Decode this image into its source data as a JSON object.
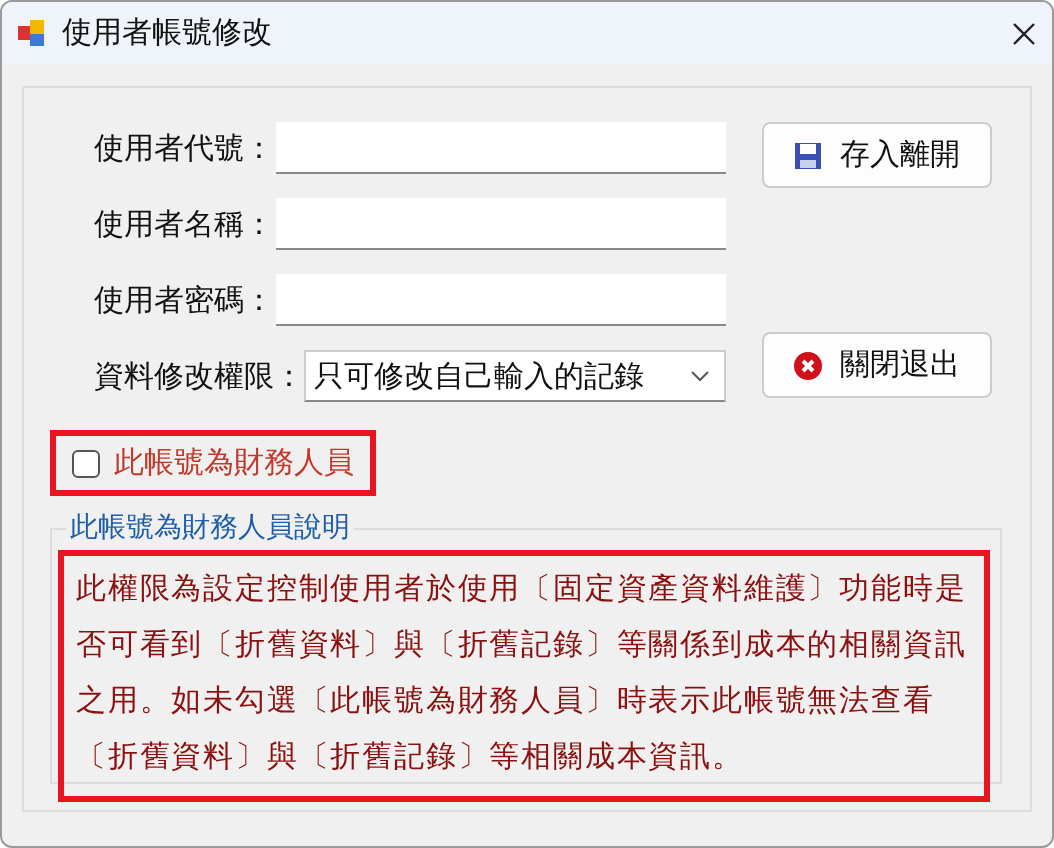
{
  "window": {
    "title": "使用者帳號修改"
  },
  "fields": [
    {
      "label": "使用者代號："
    },
    {
      "label": "使用者名稱："
    },
    {
      "label": "使用者密碼："
    }
  ],
  "permission": {
    "label": "資料修改權限：",
    "value": "只可修改自己輸入的記錄"
  },
  "buttons": [
    {
      "kind": "save",
      "label": "存入離開"
    },
    {
      "kind": "close",
      "label": "關閉退出"
    }
  ],
  "finance_checkbox": {
    "label": "此帳號為財務人員",
    "checked": false
  },
  "note": {
    "title": "此帳號為財務人員說明",
    "text": "此權限為設定控制使用者於使用〔固定資產資料維護〕功能時是否可看到〔折舊資料〕與〔折舊記錄〕等關係到成本的相關資訊之用。如未勾選〔此帳號為財務人員〕時表示此帳號無法查看〔折舊資料〕與〔折舊記錄〕等相關成本資訊。"
  }
}
